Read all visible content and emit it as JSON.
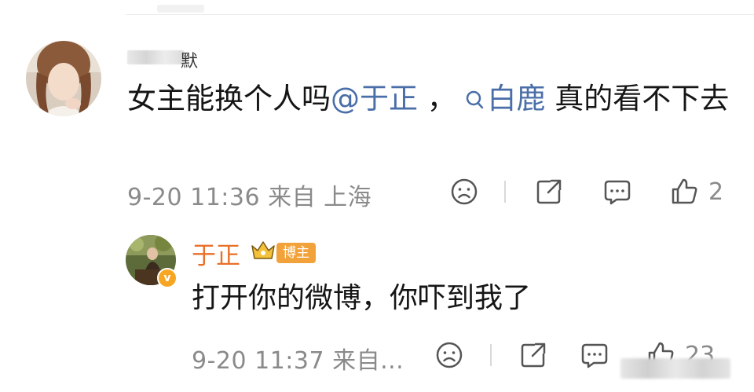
{
  "comment1": {
    "username_visible_tail": "默",
    "text_prefix": "女主能换个人吗",
    "mention": "@于正",
    "separator": " ， ",
    "topic_label": "白鹿",
    "text_suffix": " 真的看不下去",
    "meta": "9-20 11:36 来自 上海",
    "like_count": "2",
    "icons": [
      "dislike-face-icon",
      "share-icon",
      "comment-icon",
      "like-icon"
    ]
  },
  "reply": {
    "username": "于正",
    "badge_label": "博主",
    "text": "打开你的微博，你吓到我了",
    "meta": "9-20 11:37 来自...",
    "like_count": "23",
    "verified_symbol": "v",
    "icons": [
      "dislike-face-icon",
      "share-icon",
      "comment-icon",
      "like-icon"
    ]
  },
  "colors": {
    "link": "#4a6ea8",
    "username_reply": "#e8702a",
    "badge_bg": "#f2a23a",
    "meta_text": "#8a8a8a"
  }
}
